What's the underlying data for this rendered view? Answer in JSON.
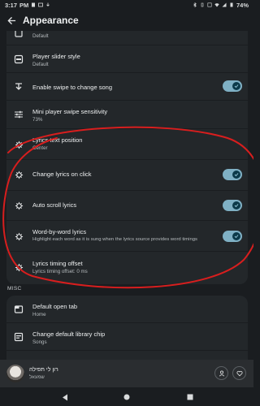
{
  "status_bar": {
    "time": "3:17",
    "time_suffix": "PM",
    "battery": "74%"
  },
  "app_bar": {
    "title": "Appearance",
    "back_icon": "arrow-left-icon"
  },
  "settings": [
    {
      "icon": "hidden-icon",
      "title": "",
      "subtitle": "Default",
      "toggle": null
    },
    {
      "icon": "slider-icon",
      "title": "Player slider style",
      "subtitle": "Default",
      "toggle": null
    },
    {
      "icon": "swipe-icon",
      "title": "Enable swipe to change song",
      "subtitle": "",
      "toggle": true
    },
    {
      "icon": "tune-icon",
      "title": "Mini player swipe sensitivity",
      "subtitle": "73%",
      "toggle": null
    },
    {
      "icon": "lyrics-icon",
      "title": "Lyrics text position",
      "subtitle": "Center",
      "toggle": null
    },
    {
      "icon": "lyrics-icon",
      "title": "Change lyrics on click",
      "subtitle": "",
      "toggle": true
    },
    {
      "icon": "lyrics-icon",
      "title": "Auto scroll lyrics",
      "subtitle": "",
      "toggle": true
    },
    {
      "icon": "lyrics-icon",
      "title": "Word-by-word lyrics",
      "subtitle": "Highlight each word as it is sung when the lyrics source provides word timings",
      "toggle": true
    },
    {
      "icon": "lyrics-icon",
      "title": "Lyrics timing offset",
      "subtitle": "Lyrics timing offset: 0 ms",
      "toggle": null
    }
  ],
  "misc_section": {
    "label": "MISC",
    "items": [
      {
        "icon": "tab-icon",
        "title": "Default open tab",
        "subtitle": "Home"
      },
      {
        "icon": "chip-icon",
        "title": "Change default library chip",
        "subtitle": "Songs"
      }
    ]
  },
  "mini_player": {
    "title": "רון לי תפילה",
    "artist": "שמעאל"
  },
  "colors": {
    "background": "#1a1d20",
    "card": "#23272a",
    "toggle_track": "#7fb0c4",
    "toggle_knob": "#0c3a4a",
    "annotation": "#d81e1e"
  }
}
